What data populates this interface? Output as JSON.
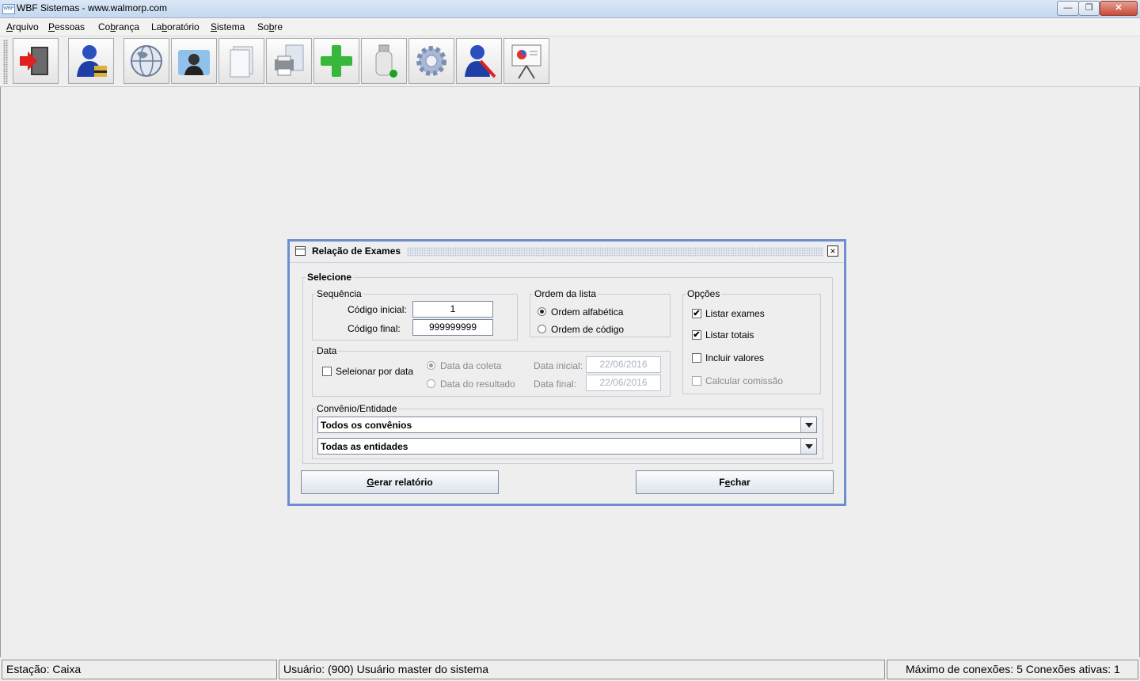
{
  "window": {
    "title": "WBF Sistemas - www.walmorp.com",
    "icon_text": "WBF",
    "minimize": "—",
    "restore": "❐",
    "close": "✕"
  },
  "menu": {
    "arquivo_pre": "",
    "arquivo_key": "A",
    "arquivo_post": "rquivo",
    "pessoas_pre": "",
    "pessoas_key": "P",
    "pessoas_post": "essoas",
    "cobranca_pre": "Co",
    "cobranca_key": "b",
    "cobranca_post": "rança",
    "laboratorio_pre": "La",
    "laboratorio_key": "b",
    "laboratorio_post": "oratório",
    "sistema_pre": "",
    "sistema_key": "S",
    "sistema_post": "istema",
    "sobre_pre": "So",
    "sobre_key": "b",
    "sobre_post": "re"
  },
  "toolbar": {
    "icons": [
      "exit-icon",
      "user-key-icon",
      "globe-icon",
      "person-photo-icon",
      "documents-icon",
      "printer-icon",
      "plus-icon",
      "usb-drive-icon",
      "settings-gear-icon",
      "user-tools-icon",
      "presentation-icon"
    ]
  },
  "dialog": {
    "title": "Relação de Exames",
    "close": "×",
    "selecione": "Selecione",
    "sequencia": {
      "legend": "Sequência",
      "codigo_inicial_label": "Código inicial:",
      "codigo_inicial_value": "1",
      "codigo_final_label": "Código final:",
      "codigo_final_value": "999999999"
    },
    "ordem": {
      "legend": "Ordem da lista",
      "alfabetica": "Ordem alfabética",
      "codigo": "Ordem de código",
      "selected": "alfabetica"
    },
    "opcoes": {
      "legend": "Opções",
      "listar_exames": "Listar exames",
      "listar_totais": "Listar totais",
      "incluir_valores": "Incluir valores",
      "calcular_comissao": "Calcular comissão",
      "check": "✔"
    },
    "data": {
      "legend": "Data",
      "seleionar_por_data": "Seleionar por data",
      "data_coleta": "Data da coleta",
      "data_resultado": "Data do resultado",
      "data_inicial_label": "Data inicial:",
      "data_inicial_value": "22/06/2016",
      "data_final_label": "Data final:",
      "data_final_value": "22/06/2016"
    },
    "convenio": {
      "legend": "Convênio/Entidade",
      "convenios_value": "Todos os convênios",
      "entidades_value": "Todas as entidades"
    },
    "buttons": {
      "gerar_key": "G",
      "gerar_rest": "erar relatório",
      "fechar_pre": "F",
      "fechar_key": "e",
      "fechar_rest": "char"
    }
  },
  "status": {
    "estacao": "Estação: Caixa",
    "usuario": "Usuário: (900) Usuário master do sistema",
    "conexoes": "Máximo de conexões: 5 Conexões ativas: 1"
  }
}
